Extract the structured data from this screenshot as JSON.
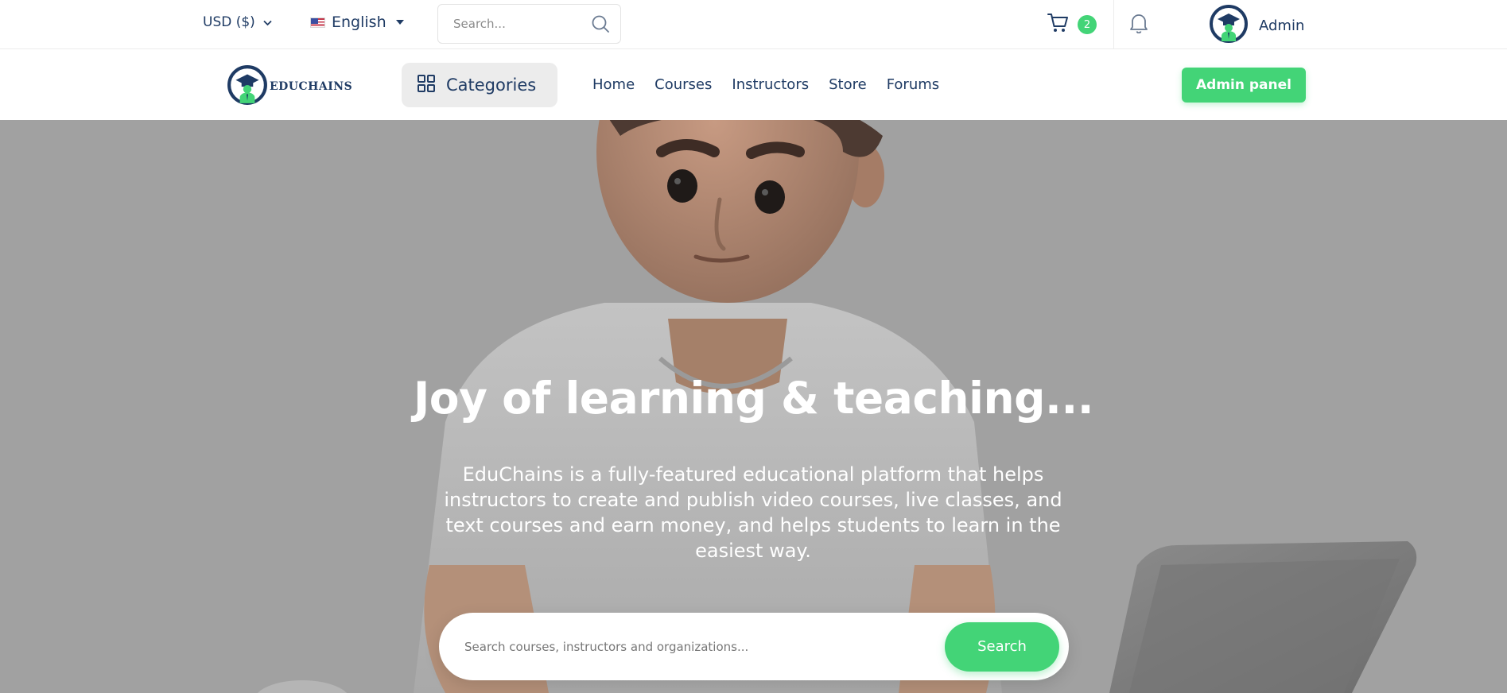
{
  "topbar": {
    "currency": "USD ($)",
    "language": "English",
    "search_placeholder": "Search...",
    "cart_count": "2",
    "user_name": "Admin"
  },
  "nav": {
    "logo_text": "EDUCHAINS",
    "categories_label": "Categories",
    "links": [
      "Home",
      "Courses",
      "Instructors",
      "Store",
      "Forums"
    ],
    "admin_button": "Admin panel"
  },
  "hero": {
    "title": "Joy of learning & teaching...",
    "description": "EduChains is a fully-featured educational platform that helps instructors to create and publish video courses, live classes, and text courses and earn money, and helps students to learn in the easiest way.",
    "search_placeholder": "Search courses, instructors and organizations...",
    "search_button": "Search"
  },
  "colors": {
    "primary": "#43d477",
    "text": "#1f3b64",
    "overlay": "#9e9e9e"
  },
  "icons": [
    "chevron-down-icon",
    "us-flag-icon",
    "caret-down-icon",
    "search-icon",
    "cart-icon",
    "bell-icon",
    "avatar-logo-icon",
    "grid-icon"
  ]
}
